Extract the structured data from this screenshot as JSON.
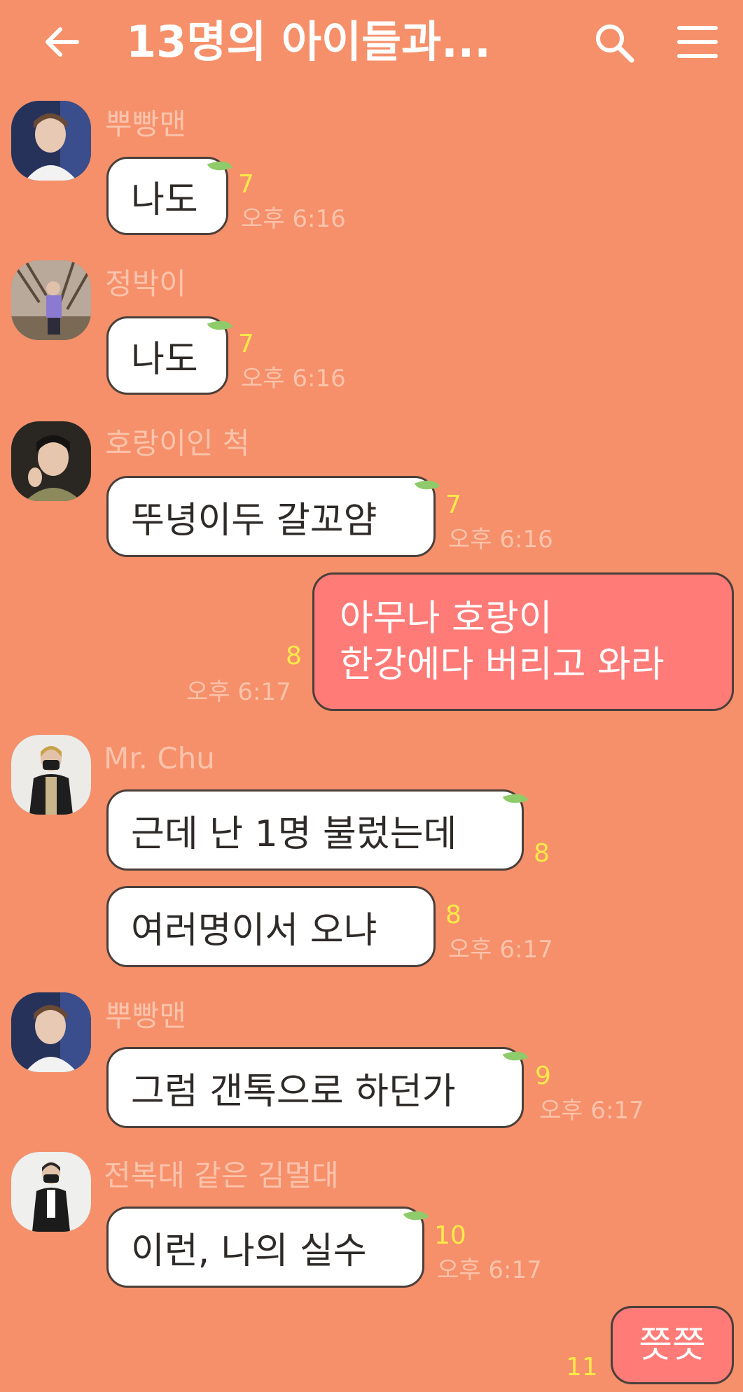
{
  "header": {
    "title": "13명의 아이들과...",
    "back_icon": "arrow-left-icon",
    "search_icon": "search-icon",
    "menu_icon": "hamburger-menu-icon"
  },
  "colors": {
    "background": "#F5906A",
    "bubble_other": "#FFFFFF",
    "bubble_mine": "#FF7B78",
    "unread_count": "#FFE84A",
    "meta_text": "#FBC3AC",
    "leaf": "#8FCB6A"
  },
  "messages": [
    {
      "sender": "뿌빵맨",
      "text": "나도",
      "unread": "7",
      "time": "오후 6:16"
    },
    {
      "sender": "정박이",
      "text": "나도",
      "unread": "7",
      "time": "오후 6:16"
    },
    {
      "sender": "호랑이인 척",
      "text": "뚜녕이두 갈꼬얌",
      "unread": "7",
      "time": "오후 6:16"
    },
    {
      "mine": true,
      "lines": [
        "아무나 호랑이",
        "한강에다 버리고 와라"
      ],
      "unread": "8",
      "time": "오후 6:17"
    },
    {
      "sender": "Mr. Chu",
      "text": "근데 난 1명 불렀는데",
      "unread": "8"
    },
    {
      "text": "여러명이서 오냐",
      "unread": "8",
      "time": "오후 6:17"
    },
    {
      "sender": "뿌빵맨",
      "text": "그럼 갠톡으로 하던가",
      "unread": "9",
      "time": "오후 6:17"
    },
    {
      "sender": "전복대 같은 김멀대",
      "text": "이런, 나의 실수",
      "unread": "10",
      "time": "오후 6:17"
    },
    {
      "mine": true,
      "text": "쯧쯧",
      "unread": "11"
    }
  ]
}
